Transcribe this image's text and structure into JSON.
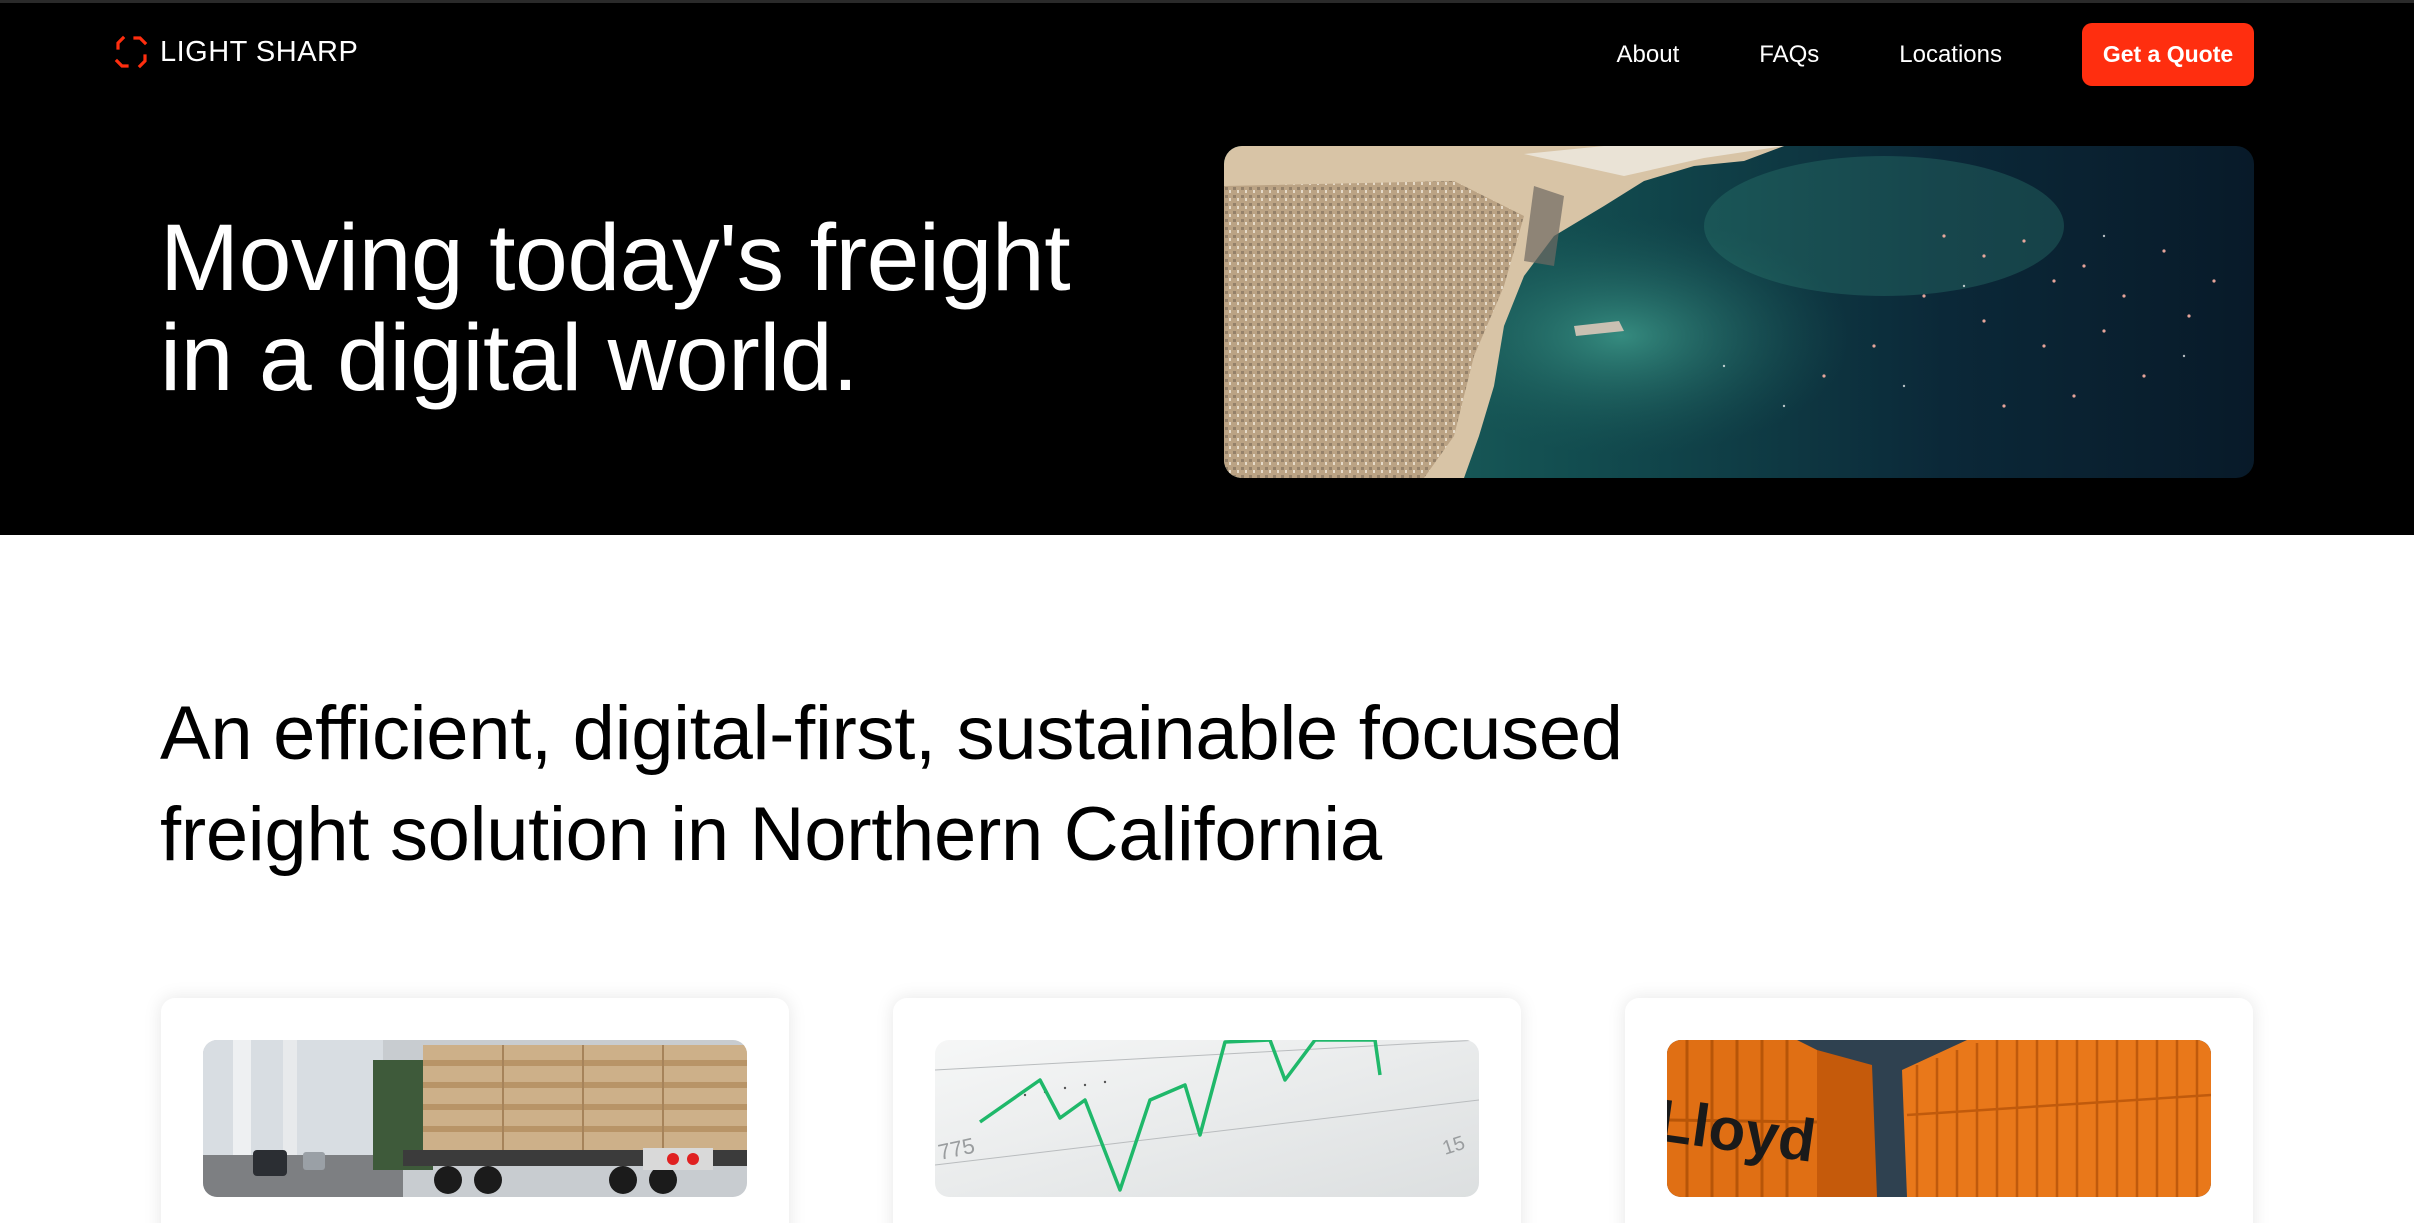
{
  "header": {
    "brand": "LIGHT SHARP",
    "nav": [
      {
        "label": "About"
      },
      {
        "label": "FAQs"
      },
      {
        "label": "Locations"
      }
    ],
    "cta_label": "Get a Quote"
  },
  "hero": {
    "title_line1": "Moving today's freight",
    "title_line2": "in a digital world.",
    "image": "satellite-port-coastline-image"
  },
  "intro": {
    "line1": "An efficient, digital-first, sustainable focused",
    "line2": "freight solution in Northern California"
  },
  "cards": [
    {
      "image": "lumber-truck-bridge-image"
    },
    {
      "image": "stock-line-graph-image",
      "graph_label": "775",
      "graph_label_2": "15"
    },
    {
      "image": "orange-shipping-containers-image",
      "container_text": "Lloyd"
    }
  ],
  "colors": {
    "accent": "#ff2e0f",
    "hero_bg": "#000000",
    "page_bg": "#ffffff",
    "graph_line": "#1fb86a"
  }
}
